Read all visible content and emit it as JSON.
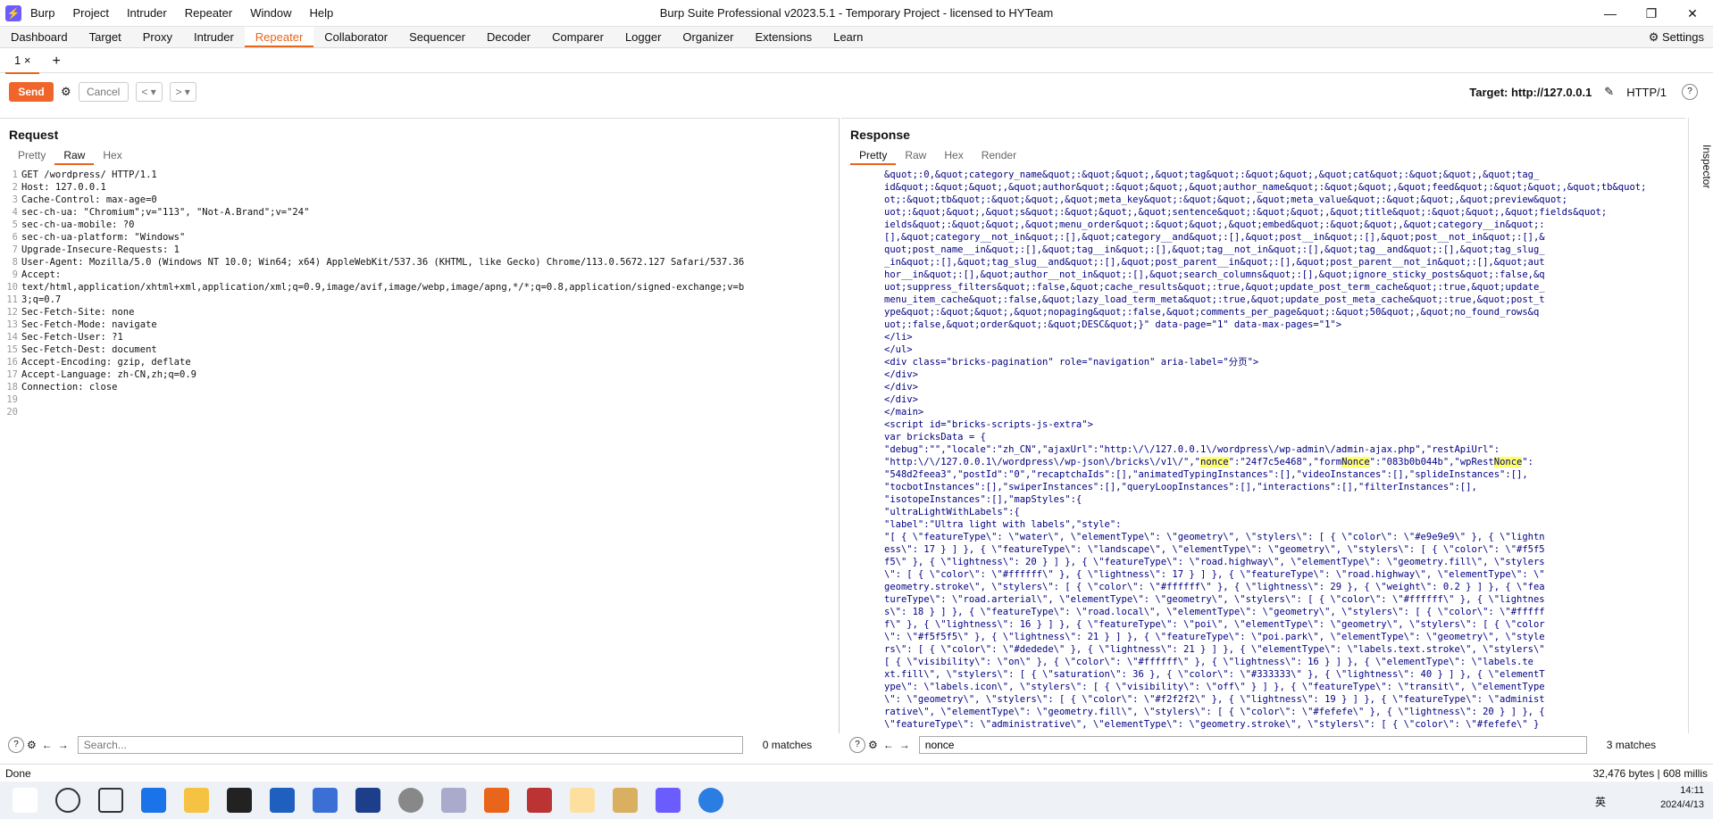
{
  "titlebar": {
    "title": "Burp Suite Professional v2023.5.1 - Temporary Project - licensed to HYTeam",
    "menu": [
      "Burp",
      "Project",
      "Intruder",
      "Repeater",
      "Window",
      "Help"
    ]
  },
  "main_tabs": [
    "Dashboard",
    "Target",
    "Proxy",
    "Intruder",
    "Repeater",
    "Collaborator",
    "Sequencer",
    "Decoder",
    "Comparer",
    "Logger",
    "Organizer",
    "Extensions",
    "Learn"
  ],
  "active_main_tab": "Repeater",
  "settings_label": "Settings",
  "repeater_tab": "1",
  "toolbar": {
    "send": "Send",
    "cancel": "Cancel",
    "target": "Target: http://127.0.0.1",
    "protocol": "HTTP/1"
  },
  "request": {
    "title": "Request",
    "tabs": [
      "Pretty",
      "Raw",
      "Hex"
    ],
    "active_tab": "Raw",
    "lines": [
      "GET /wordpress/ HTTP/1.1",
      "Host: 127.0.0.1",
      "Cache-Control: max-age=0",
      "sec-ch-ua: \"Chromium\";v=\"113\", \"Not-A.Brand\";v=\"24\"",
      "sec-ch-ua-mobile: ?0",
      "sec-ch-ua-platform: \"Windows\"",
      "Upgrade-Insecure-Requests: 1",
      "User-Agent: Mozilla/5.0 (Windows NT 10.0; Win64; x64) AppleWebKit/537.36 (KHTML, like Gecko) Chrome/113.0.5672.127 Safari/537.36",
      "Accept:",
      "text/html,application/xhtml+xml,application/xml;q=0.9,image/avif,image/webp,image/apng,*/*;q=0.8,application/signed-exchange;v=b",
      "3;q=0.7",
      "Sec-Fetch-Site: none",
      "Sec-Fetch-Mode: navigate",
      "Sec-Fetch-User: ?1",
      "Sec-Fetch-Dest: document",
      "Accept-Encoding: gzip, deflate",
      "Accept-Language: zh-CN,zh;q=0.9",
      "Connection: close",
      "",
      ""
    ],
    "search_placeholder": "Search...",
    "matches": "0 matches"
  },
  "response": {
    "title": "Response",
    "tabs": [
      "Pretty",
      "Raw",
      "Hex",
      "Render"
    ],
    "active_tab": "Pretty",
    "lines": [
      "&quot;:0,&quot;category_name&quot;:&quot;&quot;,&quot;tag&quot;:&quot;&quot;,&quot;cat&quot;:&quot;&quot;,&quot;tag_",
      "id&quot;:&quot;&quot;,&quot;author&quot;:&quot;&quot;,&quot;author_name&quot;:&quot;&quot;,&quot;feed&quot;:&quot;&quot;,&quot;tb&quot;",
      "ot;:&quot;tb&quot;:&quot;&quot;,&quot;meta_key&quot;:&quot;&quot;,&quot;meta_value&quot;:&quot;&quot;,&quot;preview&quot;",
      "uot;:&quot;&quot;,&quot;s&quot;:&quot;&quot;,&quot;sentence&quot;:&quot;&quot;,&quot;title&quot;:&quot;&quot;,&quot;fields&quot;",
      "ields&quot;:&quot;&quot;,&quot;menu_order&quot;:&quot;&quot;,&quot;embed&quot;:&quot;&quot;,&quot;category__in&quot;:",
      "[],&quot;category__not_in&quot;:[],&quot;category__and&quot;:[],&quot;post__in&quot;:[],&quot;post__not_in&quot;:[],&",
      "quot;post_name__in&quot;:[],&quot;tag__in&quot;:[],&quot;tag__not_in&quot;:[],&quot;tag__and&quot;:[],&quot;tag_slug_",
      "_in&quot;:[],&quot;tag_slug__and&quot;:[],&quot;post_parent__in&quot;:[],&quot;post_parent__not_in&quot;:[],&quot;aut",
      "hor__in&quot;:[],&quot;author__not_in&quot;:[],&quot;search_columns&quot;:[],&quot;ignore_sticky_posts&quot;:false,&q",
      "uot;suppress_filters&quot;:false,&quot;cache_results&quot;:true,&quot;update_post_term_cache&quot;:true,&quot;update_",
      "menu_item_cache&quot;:false,&quot;lazy_load_term_meta&quot;:true,&quot;update_post_meta_cache&quot;:true,&quot;post_t",
      "ype&quot;:&quot;&quot;,&quot;nopaging&quot;:false,&quot;comments_per_page&quot;:&quot;50&quot;,&quot;no_found_rows&q",
      "uot;:false,&quot;order&quot;:&quot;DESC&quot;}\" data-page=\"1\" data-max-pages=\"1\">",
      "</li>",
      "</ul>",
      "<div class=\"bricks-pagination\" role=\"navigation\" aria-label=\"分页\">",
      "</div>",
      "</div>",
      "</div>",
      "</main>",
      "<script id=\"bricks-scripts-js-extra\">",
      "var bricksData = {",
      "\"debug\":\"\",\"locale\":\"zh_CN\",\"ajaxUrl\":\"http:\\/\\/127.0.0.1\\/wordpress\\/wp-admin\\/admin-ajax.php\",\"restApiUrl\":",
      "\"http:\\/\\/127.0.0.1\\/wordpress\\/wp-json\\/bricks\\/v1\\/\",\"nonce\":\"24f7c5e468\",\"formNonce\":\"083b0b044b\",\"wpRestNonce\":",
      "\"548d2feea3\",\"postId\":\"0\",\"recaptchaIds\":[],\"animatedTypingInstances\":[],\"videoInstances\":[],\"splideInstances\":[],",
      "\"tocbotInstances\":[],\"swiperInstances\":[],\"queryLoopInstances\":[],\"interactions\":[],\"filterInstances\":[],",
      "\"isotopeInstances\":[],\"mapStyles\":{",
      "\"ultraLightWithLabels\":{",
      "\"label\":\"Ultra light with labels\",\"style\":",
      "\"[ { \\\"featureType\\\": \\\"water\\\", \\\"elementType\\\": \\\"geometry\\\", \\\"stylers\\\": [ { \\\"color\\\": \\\"#e9e9e9\\\" }, { \\\"lightn",
      "ess\\\": 17 } ] }, { \\\"featureType\\\": \\\"landscape\\\", \\\"elementType\\\": \\\"geometry\\\", \\\"stylers\\\": [ { \\\"color\\\": \\\"#f5f5",
      "f5\\\" }, { \\\"lightness\\\": 20 } ] }, { \\\"featureType\\\": \\\"road.highway\\\", \\\"elementType\\\": \\\"geometry.fill\\\", \\\"stylers",
      "\\\": [ { \\\"color\\\": \\\"#ffffff\\\" }, { \\\"lightness\\\": 17 } ] }, { \\\"featureType\\\": \\\"road.highway\\\", \\\"elementType\\\": \\\"",
      "geometry.stroke\\\", \\\"stylers\\\": [ { \\\"color\\\": \\\"#ffffff\\\" }, { \\\"lightness\\\": 29 }, { \\\"weight\\\": 0.2 } ] }, { \\\"fea",
      "tureType\\\": \\\"road.arterial\\\", \\\"elementType\\\": \\\"geometry\\\", \\\"stylers\\\": [ { \\\"color\\\": \\\"#ffffff\\\" }, { \\\"lightnes",
      "s\\\": 18 } ] }, { \\\"featureType\\\": \\\"road.local\\\", \\\"elementType\\\": \\\"geometry\\\", \\\"stylers\\\": [ { \\\"color\\\": \\\"#fffff",
      "f\\\" }, { \\\"lightness\\\": 16 } ] }, { \\\"featureType\\\": \\\"poi\\\", \\\"elementType\\\": \\\"geometry\\\", \\\"stylers\\\": [ { \\\"color",
      "\\\": \\\"#f5f5f5\\\" }, { \\\"lightness\\\": 21 } ] }, { \\\"featureType\\\": \\\"poi.park\\\", \\\"elementType\\\": \\\"geometry\\\", \\\"style",
      "rs\\\": [ { \\\"color\\\": \\\"#dedede\\\" }, { \\\"lightness\\\": 21 } ] }, { \\\"elementType\\\": \\\"labels.text.stroke\\\", \\\"stylers\\\"",
      "[ { \\\"visibility\\\": \\\"on\\\" }, { \\\"color\\\": \\\"#ffffff\\\" }, { \\\"lightness\\\": 16 } ] }, { \\\"elementType\\\": \\\"labels.te",
      "xt.fill\\\", \\\"stylers\\\": [ { \\\"saturation\\\": 36 }, { \\\"color\\\": \\\"#333333\\\" }, { \\\"lightness\\\": 40 } ] }, { \\\"elementT",
      "ype\\\": \\\"labels.icon\\\", \\\"stylers\\\": [ { \\\"visibility\\\": \\\"off\\\" } ] }, { \\\"featureType\\\": \\\"transit\\\", \\\"elementType",
      "\\\": \\\"geometry\\\", \\\"stylers\\\": [ { \\\"color\\\": \\\"#f2f2f2\\\" }, { \\\"lightness\\\": 19 } ] }, { \\\"featureType\\\": \\\"administ",
      "rative\\\", \\\"elementType\\\": \\\"geometry.fill\\\", \\\"stylers\\\": [ { \\\"color\\\": \\\"#fefefe\\\" }, { \\\"lightness\\\": 20 } ] }, {",
      "\\\"featureType\\\": \\\"administrative\\\", \\\"elementType\\\": \\\"geometry.stroke\\\", \\\"stylers\\\": [ { \\\"color\\\": \\\"#fefefe\\\" }"
    ],
    "line_number_visible": "65",
    "search_value": "nonce",
    "matches": "3 matches"
  },
  "inspector_label": "Inspector",
  "status": {
    "left": "Done",
    "right": "32,476 bytes | 608 millis"
  },
  "clock": {
    "time": "14:11",
    "date": "2024/4/13"
  },
  "taskbar_lang": "英"
}
